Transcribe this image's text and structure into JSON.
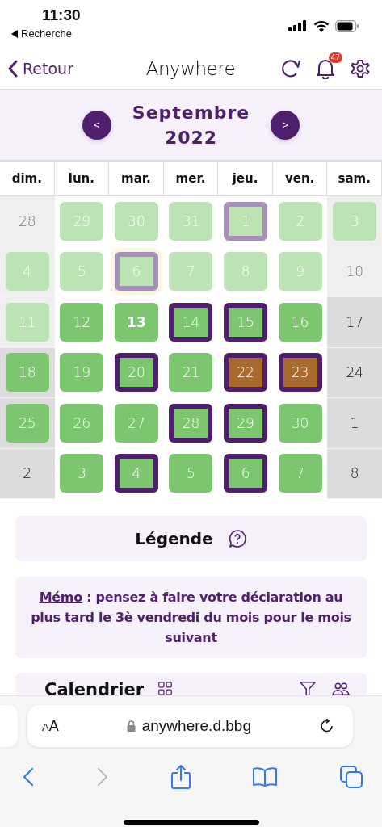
{
  "status_bar": {
    "time": "11:30",
    "back_app": "Recherche"
  },
  "header": {
    "back": "Retour",
    "title": "Anywhere",
    "notifications": "47"
  },
  "month_nav": {
    "prev": "<",
    "next": ">",
    "month": "Septembre",
    "year": "2022"
  },
  "weekdays": [
    "dim.",
    "lun.",
    "mar.",
    "mer.",
    "jeu.",
    "ven.",
    "sam."
  ],
  "weeks": [
    [
      {
        "day": "28",
        "kind": "empty",
        "faded": true
      },
      {
        "day": "29",
        "kind": "work",
        "faded": true,
        "outlined": false
      },
      {
        "day": "30",
        "kind": "work",
        "faded": true,
        "outlined": false
      },
      {
        "day": "31",
        "kind": "work",
        "faded": true,
        "outlined": false
      },
      {
        "day": "1",
        "kind": "work",
        "faded": true,
        "outlined": true
      },
      {
        "day": "2",
        "kind": "work",
        "faded": true,
        "outlined": false
      },
      {
        "day": "3",
        "kind": "work",
        "faded": true,
        "outlined": false
      }
    ],
    [
      {
        "day": "4",
        "kind": "work",
        "faded": true,
        "outlined": false
      },
      {
        "day": "5",
        "kind": "work",
        "faded": true,
        "outlined": false
      },
      {
        "day": "6",
        "kind": "work",
        "faded": true,
        "outlined": true,
        "focused": true
      },
      {
        "day": "7",
        "kind": "work",
        "faded": true,
        "outlined": false
      },
      {
        "day": "8",
        "kind": "work",
        "faded": true,
        "outlined": false
      },
      {
        "day": "9",
        "kind": "work",
        "faded": true,
        "outlined": false
      },
      {
        "day": "10",
        "kind": "empty",
        "faded": true
      }
    ],
    [
      {
        "day": "11",
        "kind": "work",
        "faded": true,
        "outlined": false
      },
      {
        "day": "12",
        "kind": "work",
        "faded": false,
        "outlined": false
      },
      {
        "day": "13",
        "kind": "work",
        "faded": false,
        "outlined": false,
        "today": true
      },
      {
        "day": "14",
        "kind": "work",
        "faded": false,
        "outlined": true
      },
      {
        "day": "15",
        "kind": "work",
        "faded": false,
        "outlined": true
      },
      {
        "day": "16",
        "kind": "work",
        "faded": false,
        "outlined": false
      },
      {
        "day": "17",
        "kind": "empty",
        "faded": false
      }
    ],
    [
      {
        "day": "18",
        "kind": "work",
        "faded": false,
        "outlined": false
      },
      {
        "day": "19",
        "kind": "work",
        "faded": false,
        "outlined": false
      },
      {
        "day": "20",
        "kind": "work",
        "faded": false,
        "outlined": true
      },
      {
        "day": "21",
        "kind": "work",
        "faded": false,
        "outlined": false
      },
      {
        "day": "22",
        "kind": "leave",
        "faded": false,
        "outlined": true
      },
      {
        "day": "23",
        "kind": "leave",
        "faded": false,
        "outlined": true
      },
      {
        "day": "24",
        "kind": "empty",
        "faded": false
      }
    ],
    [
      {
        "day": "25",
        "kind": "work",
        "faded": false,
        "outlined": false
      },
      {
        "day": "26",
        "kind": "work",
        "faded": false,
        "outlined": false
      },
      {
        "day": "27",
        "kind": "work",
        "faded": false,
        "outlined": false
      },
      {
        "day": "28",
        "kind": "work",
        "faded": false,
        "outlined": true
      },
      {
        "day": "29",
        "kind": "work",
        "faded": false,
        "outlined": true
      },
      {
        "day": "30",
        "kind": "work",
        "faded": false,
        "outlined": false
      },
      {
        "day": "1",
        "kind": "empty",
        "faded": false
      }
    ],
    [
      {
        "day": "2",
        "kind": "empty",
        "faded": false
      },
      {
        "day": "3",
        "kind": "work",
        "faded": false,
        "outlined": false
      },
      {
        "day": "4",
        "kind": "work",
        "faded": false,
        "outlined": true
      },
      {
        "day": "5",
        "kind": "work",
        "faded": false,
        "outlined": false
      },
      {
        "day": "6",
        "kind": "work",
        "faded": false,
        "outlined": true
      },
      {
        "day": "7",
        "kind": "work",
        "faded": false,
        "outlined": false
      },
      {
        "day": "8",
        "kind": "empty",
        "faded": false
      }
    ]
  ],
  "legend": {
    "title": "Légende"
  },
  "memo": {
    "link": "Mémo",
    "text": " : pensez à faire votre déclaration au plus tard le 3è vendredi du mois pour le mois suivant"
  },
  "calendar_card": {
    "title": "Calendrier"
  },
  "browser": {
    "text_size": "AA",
    "url": "anywhere.d.bbg",
    "toolbar": [
      {
        "kind": "back",
        "disabled": false
      },
      {
        "kind": "forward",
        "disabled": true
      },
      {
        "kind": "share",
        "disabled": false
      },
      {
        "kind": "bookmarks",
        "disabled": false
      },
      {
        "kind": "tabs",
        "disabled": false
      }
    ]
  }
}
